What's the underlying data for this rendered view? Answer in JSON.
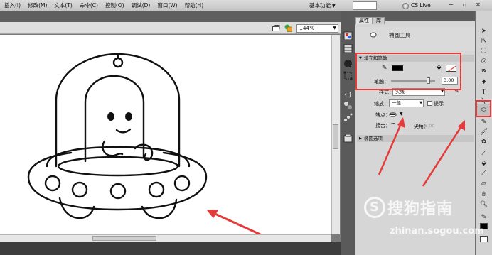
{
  "menubar": {
    "items": [
      "插入(I)",
      "修改(M)",
      "文本(T)",
      "命令(C)",
      "控制(O)",
      "调试(D)",
      "窗口(W)",
      "帮助(H)"
    ],
    "workspace": "基本功能",
    "cslive": "CS Live"
  },
  "editbar": {
    "zoom": "144%"
  },
  "panel": {
    "tabs": [
      "属性",
      "库"
    ],
    "tool_name": "椭圆工具",
    "fill_stroke_header": "填充和笔触",
    "stroke_label": "笔触：",
    "stroke_value": "3.00",
    "style_label": "样式：",
    "style_value": "实线",
    "scale_label": "缩放：",
    "scale_value": "一般",
    "hint_label": "提示",
    "cap_label": "端点：",
    "join_label": "接合：",
    "miter_label": "尖角：",
    "miter_value": "3.00",
    "ellipse_options_header": "椭圆选项"
  },
  "colors": {
    "stroke": "#000000",
    "fill": "none",
    "highlight": "#e53a3a"
  },
  "watermark": {
    "brand": "搜狗指南",
    "url": "zhinan.sogou.com"
  }
}
